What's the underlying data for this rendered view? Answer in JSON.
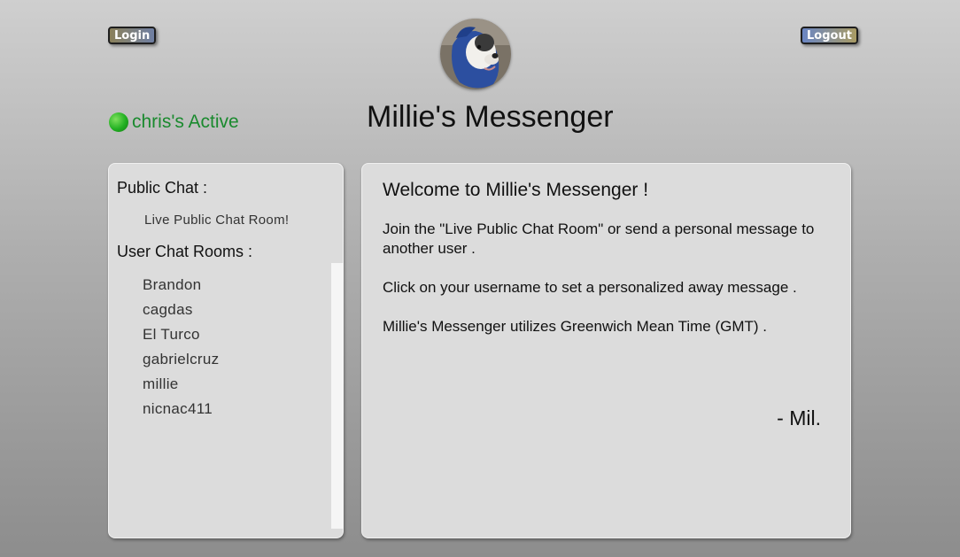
{
  "header": {
    "login_label": "Login",
    "logout_label": "Logout",
    "title": "Millie's Messenger",
    "status_text": "chris's Active",
    "status_color": "#22b022",
    "avatar_icon": "dog-avatar"
  },
  "sidebar": {
    "public_heading": "Public Chat :",
    "public_room": "Live Public Chat Room!",
    "users_heading": "User Chat Rooms :",
    "users": [
      "Brandon",
      "cagdas",
      "El Turco",
      "gabrielcruz",
      "millie",
      "nicnac411"
    ]
  },
  "main": {
    "welcome_title": "Welcome to Millie's Messenger !",
    "paragraph1": "Join the \"Live Public Chat Room\" or send a personal message to another user .",
    "paragraph2": "Click on your username to set a personalized away message .",
    "paragraph3": "Millie's Messenger utilizes Greenwich Mean Time (GMT) .",
    "signature": "- Mil."
  }
}
